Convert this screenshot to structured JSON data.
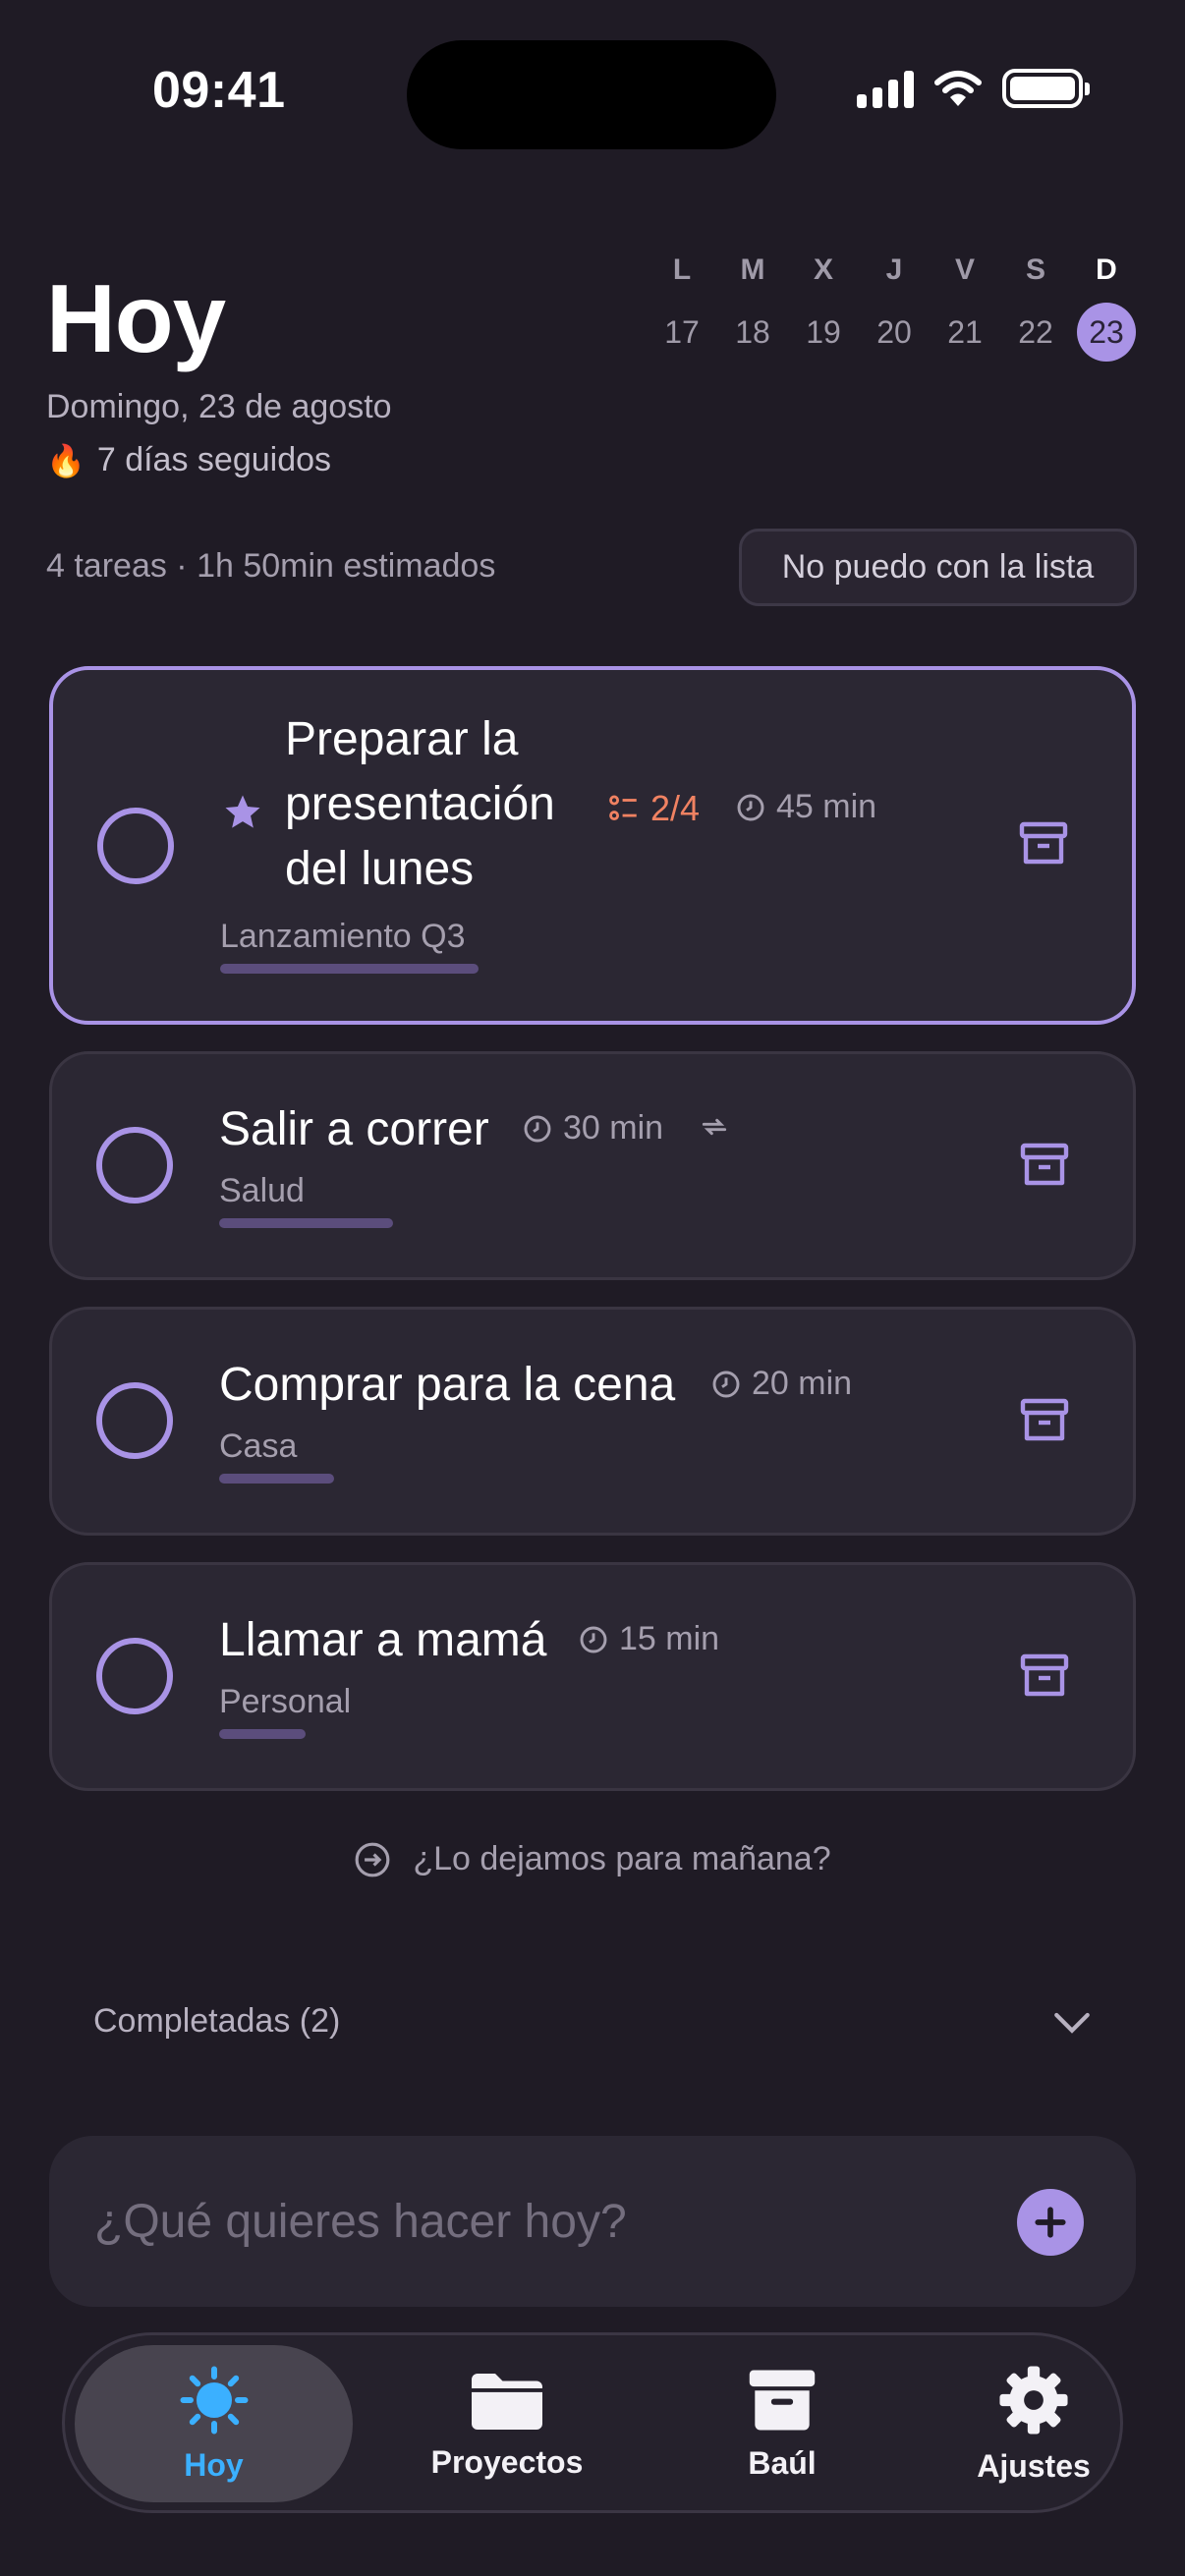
{
  "status": {
    "time": "09:41"
  },
  "header": {
    "title": "Hoy",
    "date": "Domingo, 23 de agosto",
    "streak_icon": "🔥",
    "streak": "7 días seguidos"
  },
  "week": [
    {
      "letter": "L",
      "num": "17"
    },
    {
      "letter": "M",
      "num": "18"
    },
    {
      "letter": "X",
      "num": "19"
    },
    {
      "letter": "J",
      "num": "20"
    },
    {
      "letter": "V",
      "num": "21"
    },
    {
      "letter": "S",
      "num": "22"
    },
    {
      "letter": "D",
      "num": "23",
      "active": true
    }
  ],
  "summary": {
    "text": "4 tareas · 1h 50min estimados",
    "overwhelm_button": "No puedo con la lista"
  },
  "tasks": [
    {
      "title_lines": [
        "Preparar la",
        "presentación",
        "del lunes"
      ],
      "starred": true,
      "subtasks": "2/4",
      "duration": "45 min",
      "project": "Lanzamiento Q3"
    },
    {
      "title": "Salir a correr",
      "duration": "30 min",
      "recurring": true,
      "project": "Salud"
    },
    {
      "title": "Comprar para la cena",
      "duration": "20 min",
      "project": "Casa"
    },
    {
      "title": "Llamar a mamá",
      "duration": "15 min",
      "project": "Personal"
    }
  ],
  "postpone": "¿Lo dejamos para mañana?",
  "completed": {
    "label": "Completadas (2)"
  },
  "add": {
    "placeholder": "¿Qué quieres hacer hoy?"
  },
  "tabs": [
    {
      "label": "Hoy",
      "icon": "sun-icon",
      "active": true
    },
    {
      "label": "Proyectos",
      "icon": "folder-icon"
    },
    {
      "label": "Baúl",
      "icon": "archive-icon"
    },
    {
      "label": "Ajustes",
      "icon": "gear-icon"
    }
  ],
  "colors": {
    "background": "#1f1b25",
    "card": "#2b2733",
    "accent": "#a993e6",
    "subtask": "#f08262",
    "tab_active": "#3bb0ff"
  }
}
